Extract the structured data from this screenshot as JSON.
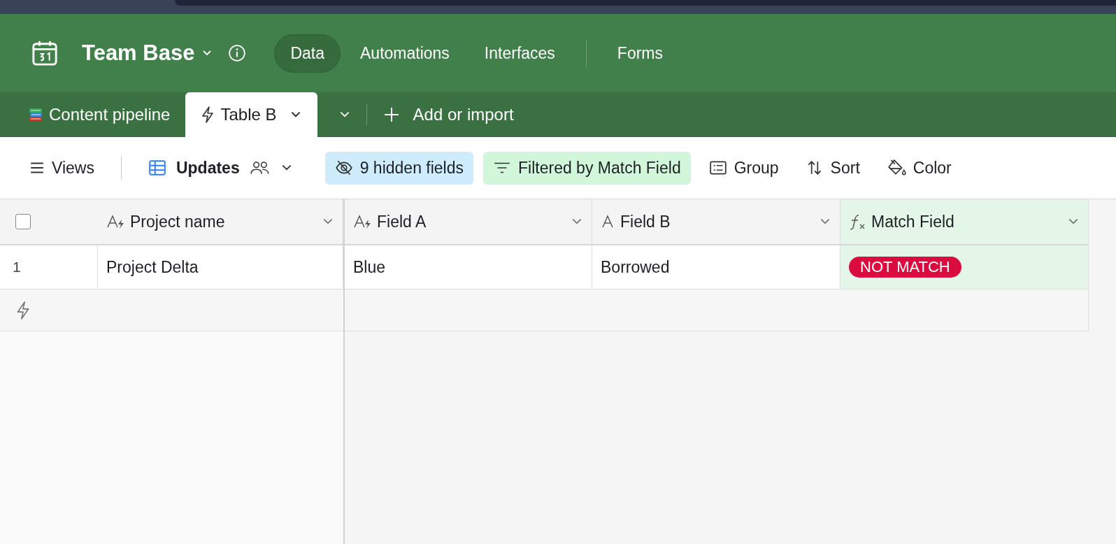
{
  "app": {
    "title": "Team Base",
    "nav": [
      {
        "label": "Data",
        "selected": true
      },
      {
        "label": "Automations",
        "selected": false
      },
      {
        "label": "Interfaces",
        "selected": false
      },
      {
        "label": "Forms",
        "selected": false
      }
    ]
  },
  "table_tabs": {
    "tabs": [
      {
        "kind": "books",
        "label": "Content pipeline",
        "selected": false
      },
      {
        "kind": "bolt",
        "label": "Table B",
        "selected": true
      }
    ],
    "add_label": "Add or import"
  },
  "toolbar": {
    "views": "Views",
    "view_name": "Updates",
    "buttons": [
      {
        "kind": "hidden",
        "label": "9 hidden fields"
      },
      {
        "kind": "filter",
        "label": "Filtered by Match Field"
      },
      {
        "kind": "group",
        "label": "Group"
      },
      {
        "kind": "sort",
        "label": "Sort"
      },
      {
        "kind": "color",
        "label": "Color"
      }
    ]
  },
  "grid": {
    "select_all": {
      "checked": false
    },
    "columns": [
      {
        "name": "Project name",
        "kind": "ai-text",
        "highlighted": false
      },
      {
        "name": "Field A",
        "kind": "ai-text",
        "highlighted": false
      },
      {
        "name": "Field B",
        "kind": "text",
        "highlighted": false
      },
      {
        "name": "Match Field",
        "kind": "formula",
        "highlighted": true
      }
    ],
    "rows": [
      {
        "number": "1",
        "cells": [
          {
            "text": "Project Delta"
          },
          {
            "text": "Blue"
          },
          {
            "text": "Borrowed"
          },
          {
            "pill": "NOT MATCH",
            "color": "#dc0b3f"
          }
        ]
      }
    ]
  }
}
